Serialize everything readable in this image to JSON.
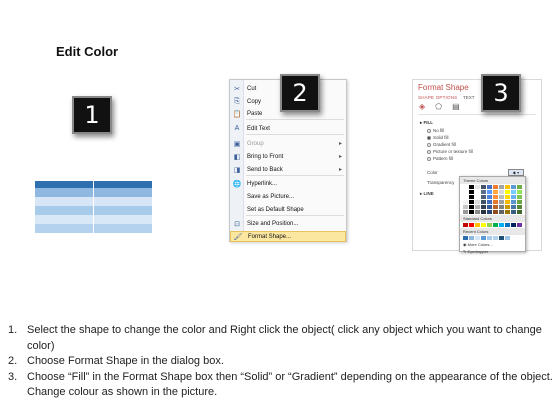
{
  "title": "Edit Color",
  "badges": [
    "1",
    "2",
    "3"
  ],
  "context_menu": {
    "items": [
      {
        "label": "Cut",
        "icon": "scissors-icon",
        "glyph": "✂",
        "disabled": false,
        "submenu": false
      },
      {
        "label": "Copy",
        "icon": "copy-icon",
        "glyph": "⎘",
        "disabled": false,
        "submenu": false
      },
      {
        "label": "Paste",
        "icon": "paste-icon",
        "glyph": "📋",
        "disabled": false,
        "submenu": false
      },
      {
        "label": "Edit Text",
        "icon": "edit-text-icon",
        "glyph": "A",
        "disabled": false,
        "submenu": false
      },
      {
        "label": "Group",
        "icon": "group-icon",
        "glyph": "▣",
        "disabled": true,
        "submenu": true
      },
      {
        "label": "Bring to Front",
        "icon": "bring-front-icon",
        "glyph": "◧",
        "disabled": false,
        "submenu": true
      },
      {
        "label": "Send to Back",
        "icon": "send-back-icon",
        "glyph": "◨",
        "disabled": false,
        "submenu": true
      },
      {
        "label": "Hyperlink...",
        "icon": "hyperlink-icon",
        "glyph": "🌐",
        "disabled": false,
        "submenu": false
      },
      {
        "label": "Save as Picture...",
        "icon": "",
        "glyph": "",
        "disabled": false,
        "submenu": false
      },
      {
        "label": "Set as Default Shape",
        "icon": "",
        "glyph": "",
        "disabled": false,
        "submenu": false
      },
      {
        "label": "Size and Position...",
        "icon": "size-position-icon",
        "glyph": "⊡",
        "disabled": false,
        "submenu": false
      },
      {
        "label": "Format Shape...",
        "icon": "format-shape-icon",
        "glyph": "🖌",
        "disabled": false,
        "submenu": false,
        "selected": true
      }
    ]
  },
  "format_pane": {
    "title": "Format Shape",
    "tab_shape_options": "SHAPE OPTIONS",
    "tab_text": "TEXT",
    "fill_header": "▸ FILL",
    "options": [
      "No fill",
      "Solid fill",
      "Gradient fill",
      "Picture or texture fill",
      "Pattern fill"
    ],
    "selected_option": "Solid fill",
    "color_label": "Color",
    "transparency_label": "Transparency",
    "line_header": "▸ LINE",
    "palette": {
      "theme_colors": "Theme Colors",
      "standard_colors": "Standard Colors",
      "recent_colors": "Recent Colors",
      "more_colors": "More Colors...",
      "eyedropper": "Eyedropper"
    }
  },
  "steps": [
    {
      "num": "1.",
      "text": "Select the shape to change the color and Right click the object( click any object which you want to change color)"
    },
    {
      "num": "2.",
      "text": "Choose Format Shape in the dialog box."
    },
    {
      "num": "3.",
      "text": "Choose “Fill” in the Format Shape box then “Solid” or “Gradient” depending on the appearance of the object. Change colour as shown in the picture."
    }
  ],
  "colors": {
    "accent_red": "#c0504d",
    "table_header": "#2e6fb0",
    "menu_highlight": "#fbe7a0"
  }
}
